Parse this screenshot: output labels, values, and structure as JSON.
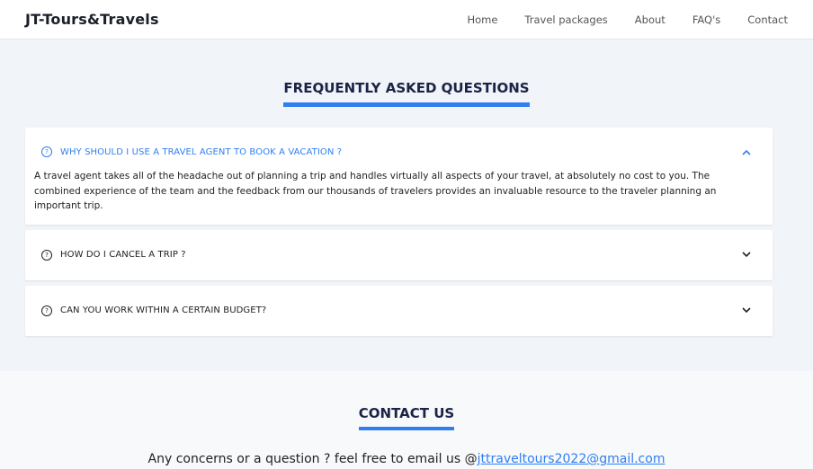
{
  "navbar": {
    "brand": "JT-Tours&Travels",
    "links": [
      "Home",
      "Travel packages",
      "About",
      "FAQ's",
      "Contact"
    ]
  },
  "faq": {
    "title": "FREQUENTLY ASKED QUESTIONS",
    "items": [
      {
        "question": "WHY SHOULD I USE A TRAVEL AGENT TO BOOK A VACATION ?",
        "answer": "A travel agent takes all of the headache out of planning a trip and handles virtually all aspects of your travel, at absolutely no cost to you. The combined experience of the team and the feedback from our thousands of travelers provides an invaluable resource to the traveler planning an important trip.",
        "expanded": true
      },
      {
        "question": "HOW DO I CANCEL A TRIP ?",
        "expanded": false
      },
      {
        "question": "CAN YOU WORK WITHIN A CERTAIN BUDGET?",
        "expanded": false
      }
    ],
    "q_icon": "?"
  },
  "contact": {
    "title": "CONTACT US",
    "text": "Any concerns or a question ? feel free to email us @",
    "email": "jttraveltours2022@gmail.com"
  },
  "colors": {
    "accent": "#2f7ff0",
    "heading": "#1b2346"
  }
}
